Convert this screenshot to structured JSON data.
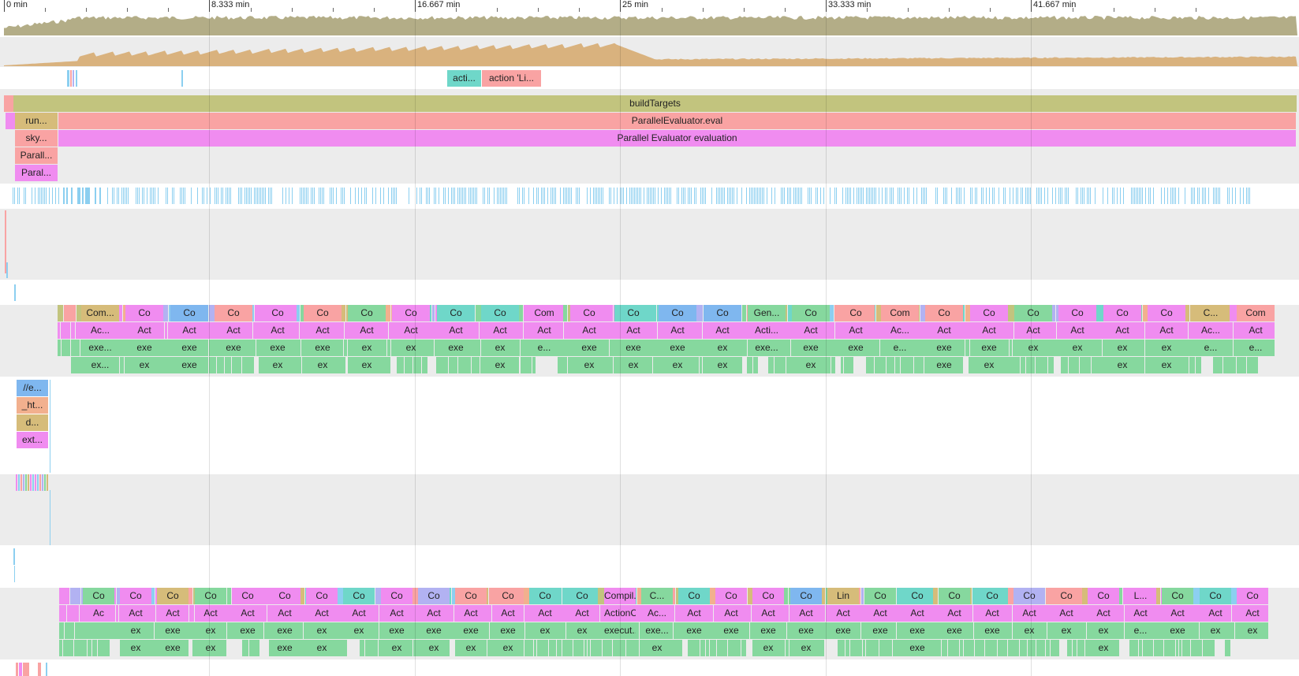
{
  "timeline": {
    "ticks": [
      "0 min",
      "8.333 min",
      "16.667 min",
      "25 min",
      "33.333 min",
      "41.667 min"
    ]
  },
  "colors": {
    "cpu": "#b3ad87",
    "memory": "#d9b27e",
    "blue": "#8ccff0",
    "olive": "#c2c47e",
    "salmon": "#f9a3a3",
    "magenta": "#f08cf0",
    "green": "#86d89e",
    "teal": "#6fd7c9",
    "tan": "#d6bc7a",
    "lavender": "#b2b2f2",
    "peach": "#f2b08e",
    "skyblue": "#7fb7ef",
    "band_gray": "#ececec"
  },
  "actions_row": {
    "a1": "acti...",
    "a2": "action 'Li..."
  },
  "main_thread": {
    "build_targets": "buildTargets",
    "run": "run...",
    "parallel_eval": "ParallelEvaluator.eval",
    "sky": "sky...",
    "parallel_eval_eval": "Parallel Evaluator evaluation",
    "parall1": "Parall...",
    "parall2": "Paral..."
  },
  "lane1": {
    "row0": [
      {
        "t": "Com...",
        "c": "tan"
      },
      {
        "t": "Co",
        "c": "magenta"
      },
      {
        "t": "Co",
        "c": "skyblue"
      },
      {
        "t": "Co",
        "c": "salmon"
      },
      {
        "t": "Co",
        "c": "magenta"
      },
      {
        "t": "Co",
        "c": "salmon"
      },
      {
        "t": "Co",
        "c": "green"
      },
      {
        "t": "Co",
        "c": "magenta"
      },
      {
        "t": "Co",
        "c": "teal"
      },
      {
        "t": "Co",
        "c": "teal"
      },
      {
        "t": "Com",
        "c": "magenta"
      },
      {
        "t": "Co",
        "c": "magenta"
      },
      {
        "t": "Co",
        "c": "teal"
      },
      {
        "t": "Co",
        "c": "skyblue"
      },
      {
        "t": "Co",
        "c": "skyblue"
      },
      {
        "t": "Gen...",
        "c": "green"
      },
      {
        "t": "Co",
        "c": "green"
      },
      {
        "t": "Co",
        "c": "salmon"
      },
      {
        "t": "Com",
        "c": "salmon"
      },
      {
        "t": "Co",
        "c": "salmon"
      },
      {
        "t": "Co",
        "c": "magenta"
      },
      {
        "t": "Co",
        "c": "green"
      },
      {
        "t": "Co",
        "c": "magenta"
      },
      {
        "t": "Co",
        "c": "magenta"
      },
      {
        "t": "Co",
        "c": "magenta"
      },
      {
        "t": "C...",
        "c": "tan"
      },
      {
        "t": "Com",
        "c": "salmon"
      }
    ],
    "row1": [
      "Ac...",
      "Act",
      "Act",
      "Act",
      "Act",
      "Act",
      "Act",
      "Act",
      "Act",
      "Act",
      "Act",
      "Act",
      "Act",
      "Act",
      "Act",
      "Acti...",
      "Act",
      "Act",
      "Ac...",
      "Act",
      "Act",
      "Act",
      "Act",
      "Act",
      "Act",
      "Ac...",
      "Act"
    ],
    "row2": [
      "exe...",
      "exe",
      "exe",
      "exe",
      "exe",
      "exe",
      "ex",
      "ex",
      "exe",
      "ex",
      "e...",
      "exe",
      "exe",
      "exe",
      "ex",
      "exe...",
      "exe",
      "exe",
      "e...",
      "exe",
      "exe",
      "ex",
      "ex",
      "ex",
      "ex",
      "e...",
      "e..."
    ],
    "row3": [
      "ex...",
      "ex",
      "exe",
      "",
      "ex",
      "ex",
      "ex",
      "",
      "",
      "ex",
      "",
      "ex",
      "ex",
      "ex",
      "ex",
      "",
      "ex",
      "",
      "",
      "exe",
      "ex",
      "",
      "",
      "ex",
      "ex",
      "",
      ""
    ]
  },
  "lane2": {
    "items": [
      "//e...",
      "_ht...",
      "d...",
      "ext..."
    ]
  },
  "lane3": {
    "row0": [
      {
        "t": "Co",
        "c": "green"
      },
      {
        "t": "Co",
        "c": "magenta"
      },
      {
        "t": "Co",
        "c": "tan"
      },
      {
        "t": "Co",
        "c": "green"
      },
      {
        "t": "Co",
        "c": "magenta"
      },
      {
        "t": "Co",
        "c": "magenta"
      },
      {
        "t": "Co",
        "c": "magenta"
      },
      {
        "t": "Co",
        "c": "teal"
      },
      {
        "t": "Co",
        "c": "magenta"
      },
      {
        "t": "Co",
        "c": "lavender"
      },
      {
        "t": "Co",
        "c": "salmon"
      },
      {
        "t": "Co",
        "c": "salmon"
      },
      {
        "t": "Co",
        "c": "teal"
      },
      {
        "t": "Co",
        "c": "teal"
      },
      {
        "t": "Compil...",
        "c": "magenta"
      },
      {
        "t": "C...",
        "c": "green"
      },
      {
        "t": "Co",
        "c": "teal"
      },
      {
        "t": "Co",
        "c": "magenta"
      },
      {
        "t": "Co",
        "c": "magenta"
      },
      {
        "t": "Co",
        "c": "skyblue"
      },
      {
        "t": "Lin",
        "c": "tan"
      },
      {
        "t": "Co",
        "c": "green"
      },
      {
        "t": "Co",
        "c": "teal"
      },
      {
        "t": "Co",
        "c": "green"
      },
      {
        "t": "Co",
        "c": "teal"
      },
      {
        "t": "Co",
        "c": "lavender"
      },
      {
        "t": "Co",
        "c": "salmon"
      },
      {
        "t": "Co",
        "c": "magenta"
      },
      {
        "t": "L...",
        "c": "magenta"
      },
      {
        "t": "Co",
        "c": "green"
      },
      {
        "t": "Co",
        "c": "teal"
      },
      {
        "t": "Co",
        "c": "magenta"
      }
    ],
    "row1": [
      "Ac",
      "Act",
      "Act",
      "Act",
      "Act",
      "Act",
      "Act",
      "Act",
      "Act",
      "Act",
      "Act",
      "Act",
      "Act",
      "Act",
      "ActionC...",
      "Ac...",
      "Act",
      "Act",
      "Act",
      "Act",
      "Act",
      "Act",
      "Act",
      "Act",
      "Act",
      "Act",
      "Act",
      "Act",
      "Act",
      "Act",
      "Act",
      "Act"
    ],
    "row2": [
      "",
      "ex",
      "exe",
      "ex",
      "exe",
      "exe",
      "ex",
      "ex",
      "exe",
      "exe",
      "exe",
      "exe",
      "ex",
      "ex",
      "execut...",
      "exe...",
      "exe",
      "exe",
      "exe",
      "exe",
      "exe",
      "exe",
      "exe",
      "exe",
      "exe",
      "ex",
      "ex",
      "ex",
      "e...",
      "exe",
      "ex",
      "ex"
    ],
    "row3": [
      "",
      "ex",
      "exe",
      "ex",
      "",
      "exe",
      "ex",
      "",
      "ex",
      "ex",
      "ex",
      "ex",
      "",
      "",
      "",
      "ex",
      "",
      "",
      "ex",
      "ex",
      "",
      "",
      "exe",
      "",
      "",
      "",
      "",
      "ex",
      "",
      "",
      "",
      ""
    ]
  }
}
